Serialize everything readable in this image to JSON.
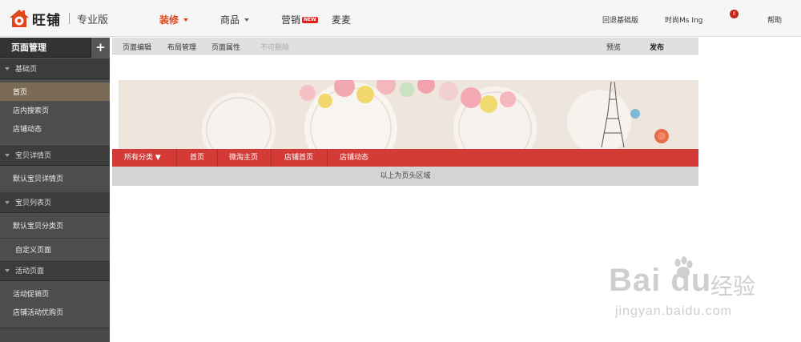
{
  "header": {
    "logo_text": "旺铺",
    "edition": "专业版",
    "nav": [
      {
        "label": "装修",
        "has_dropdown": true,
        "active": true
      },
      {
        "label": "商品",
        "has_dropdown": true
      },
      {
        "label": "营销",
        "badge": "NEW"
      },
      {
        "label": "麦麦"
      }
    ],
    "right": {
      "back_to_basic": "回退基础版",
      "user": "时尚Ms Ing",
      "message_count": "0",
      "help": "帮助"
    },
    "accent_color": "#e0451b"
  },
  "sidebar": {
    "title": "页面管理",
    "add_label": "+",
    "groups": [
      {
        "label": "基础页",
        "items": [
          "首页",
          "店内搜索页",
          "店铺动态"
        ]
      },
      {
        "label": "宝贝详情页",
        "items": [
          "默认宝贝详情页"
        ]
      },
      {
        "label": "宝贝列表页",
        "items": [
          "默认宝贝分类页",
          "自定义页面"
        ]
      },
      {
        "label": "活动页面",
        "items": [
          "活动促销页",
          "店铺活动优购页"
        ]
      }
    ],
    "active_item": "首页"
  },
  "toolbar": {
    "page_edit": "页面编辑",
    "layout_manage": "布局管理",
    "page_props": "页面属性",
    "not_deletable": "不可删除",
    "preview": "预览",
    "publish": "发布"
  },
  "shop_nav": {
    "all_categories": "所有分类 ▼",
    "items": [
      "首页",
      "微淘主页",
      "店铺首页",
      "店铺动态"
    ],
    "color": "#d53b36"
  },
  "header_area_tip": "以上为页头区域",
  "watermark": {
    "brand": "Bai du",
    "cn": "经验",
    "url": "jingyan.baidu.com"
  }
}
